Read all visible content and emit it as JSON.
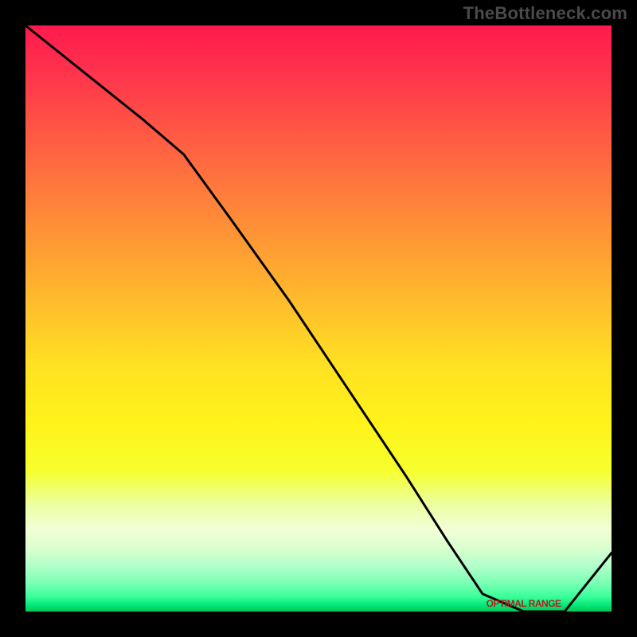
{
  "watermark": "TheBottleneck.com",
  "chart_data": {
    "type": "line",
    "note": "Axes are unlabeled in the source image. x runs 0..1 left-to-right, y is bottleneck percentage 0..1 (top = 1.0, bottom = 0.0). Values estimated from curve geometry.",
    "x": [
      0.0,
      0.1,
      0.2,
      0.27,
      0.35,
      0.45,
      0.55,
      0.65,
      0.72,
      0.78,
      0.85,
      0.92,
      1.0
    ],
    "y": [
      1.0,
      0.92,
      0.84,
      0.78,
      0.67,
      0.53,
      0.38,
      0.23,
      0.12,
      0.03,
      0.0,
      0.0,
      0.1
    ],
    "optimal_range_x": [
      0.78,
      0.92
    ],
    "optimal_label": "OPTIMAL RANGE"
  }
}
